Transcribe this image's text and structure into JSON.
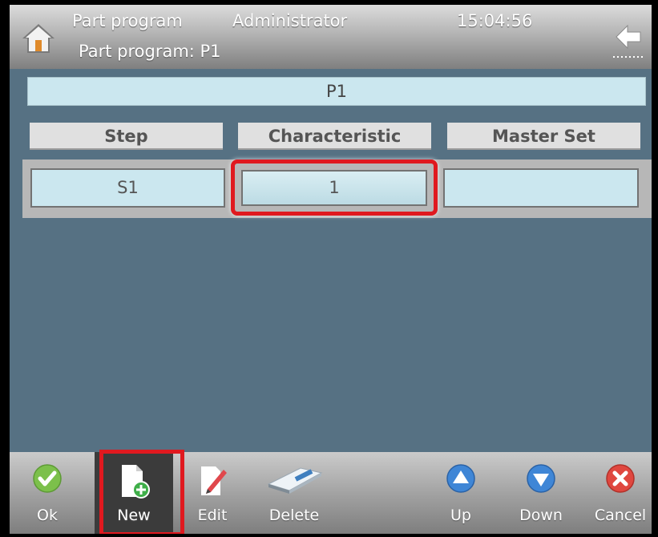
{
  "header": {
    "title": "Part program",
    "user": "Administrator",
    "time": "15:04:56",
    "subtitle": "Part program: P1",
    "home_icon": "home-icon",
    "back_icon": "back-arrow-icon"
  },
  "banner": {
    "text": "P1"
  },
  "table": {
    "columns": [
      "Step",
      "Characteristic",
      "Master Set"
    ],
    "rows": [
      {
        "step": "S1",
        "characteristic": "1",
        "master_set": ""
      }
    ]
  },
  "toolbar": {
    "buttons": [
      {
        "label": "Ok",
        "icon": "check-icon"
      },
      {
        "label": "New",
        "icon": "new-document-icon"
      },
      {
        "label": "Edit",
        "icon": "edit-icon"
      },
      {
        "label": "Delete",
        "icon": "eraser-icon"
      },
      {
        "label": "Up",
        "icon": "arrow-up-icon"
      },
      {
        "label": "Down",
        "icon": "arrow-down-icon"
      },
      {
        "label": "Cancel",
        "icon": "cancel-icon"
      }
    ]
  },
  "colors": {
    "background": "#567183",
    "cell": "#cbe7ef",
    "highlight": "#e0191f",
    "ok_green": "#7cc04b",
    "up_down_blue": "#3f86d6",
    "cancel_red": "#e0473f"
  }
}
